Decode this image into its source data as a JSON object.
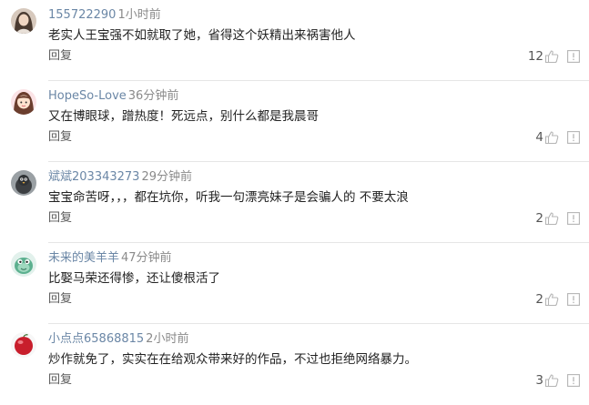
{
  "colors": {
    "username": "#6b87a6",
    "timestamp": "#8a8a8a",
    "content_text": "#222222",
    "reply_text": "#5a5a5a",
    "icon_stroke": "#b5b5b5",
    "divider": "#e6e6e6"
  },
  "icons": {
    "like": "thumbs-up-icon",
    "report": "report-icon"
  },
  "comments": [
    {
      "username": "155722290",
      "time": "1小时前",
      "text": "老实人王宝强不如就取了她，省得这个妖精出来祸害他人",
      "reply_label": "回复",
      "likes": "12",
      "avatar": "woman-photo-avatar"
    },
    {
      "username": "HopeSo-Love",
      "time": "36分钟前",
      "text": "又在博眼球，蹭热度！死远点，别什么都是我晨哥",
      "reply_label": "回复",
      "likes": "4",
      "avatar": "cartoon-girl-avatar"
    },
    {
      "username": "斌斌203343273",
      "time": "29分钟前",
      "text": "宝宝命苦呀，，，都在坑你，听我一句漂亮妹子是会骗人的 不要太浪",
      "reply_label": "回复",
      "likes": "2",
      "avatar": "bird-photo-avatar"
    },
    {
      "username": "未来的美羊羊",
      "time": "47分钟前",
      "text": "比娶马荣还得惨，还让傻根活了",
      "reply_label": "回复",
      "likes": "2",
      "avatar": "green-cartoon-avatar"
    },
    {
      "username": "小点点65868815",
      "time": "2小时前",
      "text": "炒作就免了，实实在在给观众带来好的作品，不过也拒绝网络暴力。",
      "reply_label": "回复",
      "likes": "3",
      "avatar": "red-ball-avatar"
    }
  ]
}
